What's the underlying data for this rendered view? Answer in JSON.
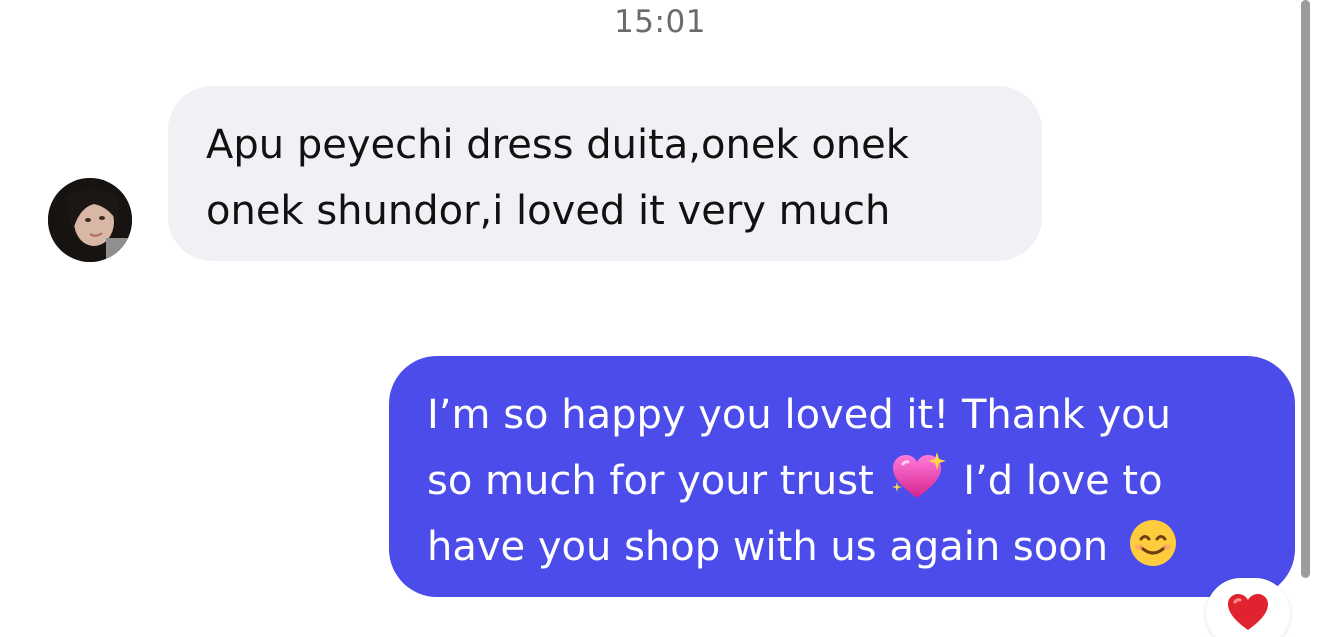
{
  "conversation": {
    "timestamp": "15:01",
    "incoming": {
      "line1": "Apu peyechi dress duita,onek onek",
      "line2": "onek shundor,i loved it very much",
      "bubble_color": "#f1f1f5"
    },
    "outgoing": {
      "line1": "I’m so happy you loved it! Thank you",
      "line2a": "so much for your trust",
      "line2b": "I’d love to",
      "line3": "have you shop with us again soon",
      "bubble_color": "#4b4ce9",
      "emoji_1": "sparkling-heart-icon",
      "emoji_2": "smiling-face-icon"
    },
    "reaction": {
      "icon": "red-heart-icon"
    }
  }
}
